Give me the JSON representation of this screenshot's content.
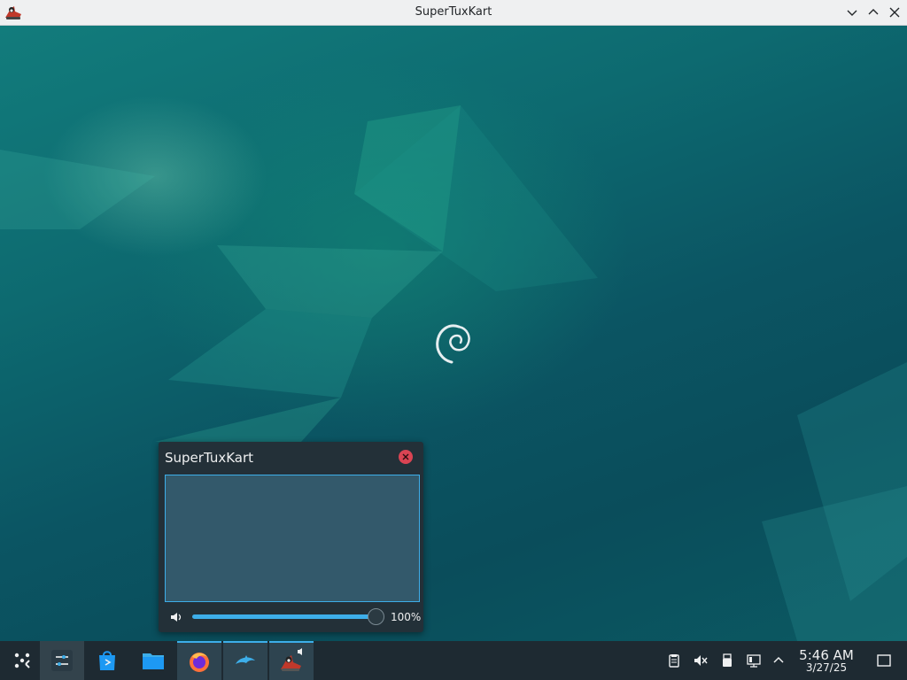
{
  "window": {
    "title": "SuperTuxKart",
    "icon": "supertuxkart-icon",
    "controls": [
      "minimize-icon",
      "maximize-icon",
      "close-icon"
    ]
  },
  "volume_popup": {
    "title": "SuperTuxKart",
    "volume_percent_label": "100%",
    "volume_level": 1.0,
    "colors": {
      "accent": "#3daee9",
      "close": "#da4453"
    }
  },
  "taskbar": {
    "launcher": "app-launcher-icon",
    "items": [
      "system-settings-icon",
      "discover-icon",
      "file-manager-icon",
      "firefox-icon",
      "dolphin-emulator-icon",
      "supertuxkart-icon"
    ],
    "tray": [
      "clipboard-icon",
      "volume-muted-icon",
      "usb-device-icon",
      "network-icon",
      "expand-tray-icon"
    ],
    "clock": {
      "time": "5:46 AM",
      "date": "3/27/25"
    },
    "show_desktop": "show-desktop-icon"
  }
}
